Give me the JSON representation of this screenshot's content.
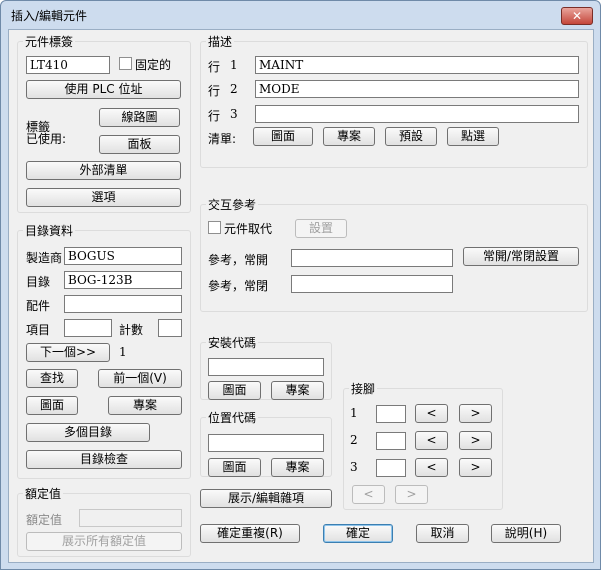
{
  "window": {
    "title": "插入/編輯元件",
    "close_glyph": "✕"
  },
  "tag_group": {
    "label": "元件標簽",
    "tag_value": "LT410",
    "fixed_label": "固定的",
    "use_plc_label": "使用 PLC 位址",
    "tag_used_label1": "標籤",
    "tag_used_label2": "已使用:",
    "drawing_btn": "線路圖",
    "panel_btn": "面板",
    "external_list_btn": "外部清單",
    "options_btn": "選項"
  },
  "desc_group": {
    "label": "描述",
    "line_label": "行",
    "lines": [
      {
        "num": "1",
        "value": "MAINT"
      },
      {
        "num": "2",
        "value": "MODE"
      },
      {
        "num": "3",
        "value": ""
      }
    ],
    "list_label": "清單:",
    "drawing_btn": "圖面",
    "project_btn": "專案",
    "default_btn": "預設",
    "pick_btn": "點選"
  },
  "catalog_group": {
    "label": "目錄資料",
    "manufacturer_label": "製造商",
    "manufacturer_value": "BOGUS",
    "catalog_label": "目錄",
    "catalog_value": "BOG-123B",
    "assembly_label": "配件",
    "assembly_value": "",
    "item_label": "項目",
    "item_value": "",
    "count_label": "計數",
    "count_value": "",
    "next_btn": "下一個>>",
    "next_value": "1",
    "lookup_btn": "查找",
    "previous_btn": "前一個(V)",
    "drawing_btn": "圖面",
    "project_btn": "專案",
    "multi_catalog_btn": "多個目錄",
    "catalog_check_btn": "目錄檢查"
  },
  "xref_group": {
    "label": "交互參考",
    "component_override_label": "元件取代",
    "setup_btn": "設置",
    "ref_no_label": "參考，常開",
    "ref_no_value": "",
    "ref_nc_label": "參考，常閉",
    "ref_nc_value": "",
    "no_nc_setup_btn": "常開/常閉設置"
  },
  "install_group": {
    "label": "安裝代碼",
    "value": "",
    "drawing_btn": "圖面",
    "project_btn": "專案"
  },
  "location_group": {
    "label": "位置代碼",
    "value": "",
    "drawing_btn": "圖面",
    "project_btn": "專案"
  },
  "pins_group": {
    "label": "接腳",
    "rows": [
      {
        "num": "1",
        "value": ""
      },
      {
        "num": "2",
        "value": ""
      },
      {
        "num": "3",
        "value": ""
      }
    ],
    "prev_glyph": "<",
    "next_glyph": ">"
  },
  "show_edit_misc_btn": "展示/編輯雜項",
  "ratings_group": {
    "label": "額定值",
    "rating_label": "額定值",
    "rating_value": "",
    "show_all_btn": "展示所有額定值"
  },
  "footer": {
    "ok_repeat_btn": "確定重複(R)",
    "ok_btn": "確定",
    "cancel_btn": "取消",
    "help_btn": "說明(H)"
  }
}
